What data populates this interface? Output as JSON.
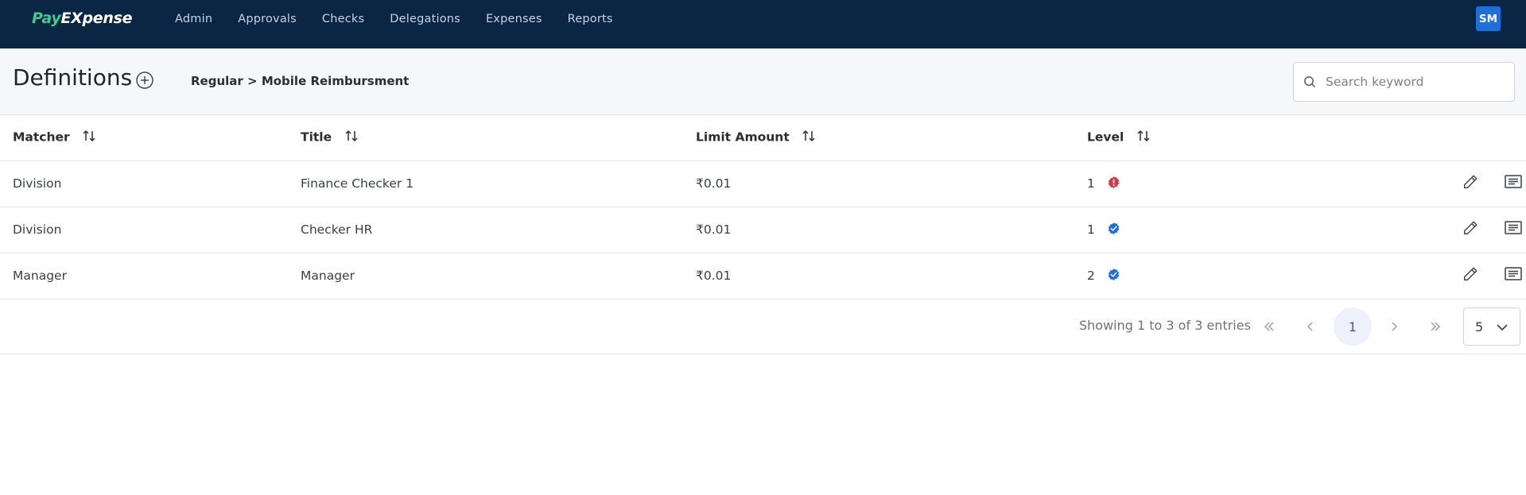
{
  "app": {
    "logo_part1": "Pay",
    "logo_part2": "EXpense",
    "nav": [
      "Admin",
      "Approvals",
      "Checks",
      "Delegations",
      "Expenses",
      "Reports"
    ],
    "user_initials": "SM",
    "colors": {
      "topbar": "#0b2545",
      "logo_accent": "#3ecf8e",
      "avatar": "#1e6fd9"
    }
  },
  "header": {
    "title": "Definitions",
    "add_icon": "plus-circle-icon",
    "breadcrumb": "Regular > Mobile Reimbursment",
    "search_placeholder": "Search keyword",
    "search_value": ""
  },
  "table": {
    "columns": [
      "Matcher",
      "Title",
      "Limit Amount",
      "Level"
    ],
    "rows": [
      {
        "matcher": "Division",
        "title": "Finance Checker 1",
        "limit": "₹0.01",
        "level": "1",
        "status": "error",
        "status_icon": "exclamation-badge-icon",
        "status_color": "#dc3545"
      },
      {
        "matcher": "Division",
        "title": "Checker HR",
        "limit": "₹0.01",
        "level": "1",
        "status": "verified",
        "status_icon": "verified-badge-icon",
        "status_color": "#1e6fd9"
      },
      {
        "matcher": "Manager",
        "title": "Manager",
        "limit": "₹0.01",
        "level": "2",
        "status": "verified",
        "status_icon": "verified-badge-icon",
        "status_color": "#1e6fd9"
      }
    ],
    "row_action_icons": [
      "pencil-icon",
      "notes-icon"
    ]
  },
  "pagination": {
    "info": "Showing 1 to 3 of 3 entries",
    "current_page": "1",
    "page_size": "5",
    "icons": [
      "first-page-icon",
      "prev-page-icon",
      "next-page-icon",
      "last-page-icon"
    ]
  }
}
